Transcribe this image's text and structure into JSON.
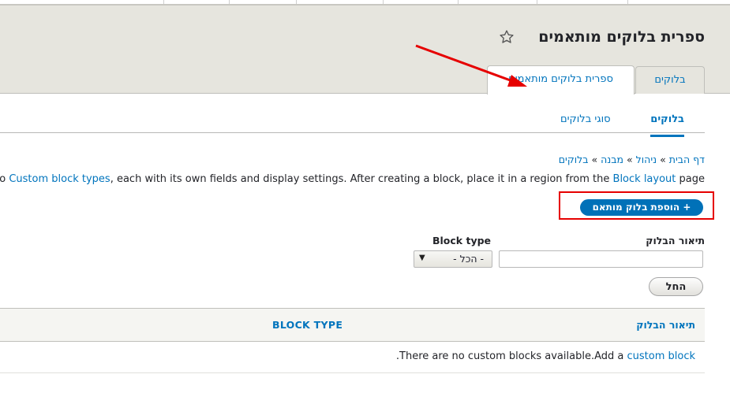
{
  "page": {
    "title": "ספרית בלוקים מותאמים"
  },
  "primary_tabs": {
    "blocks": "בלוקים",
    "library": "ספרית בלוקים מותאמים"
  },
  "secondary_tabs": {
    "blocks": "בלוקים",
    "block_types": "סוגי בלוקים"
  },
  "breadcrumb": {
    "items": [
      "דף הבית",
      "ניהול",
      "מבנה",
      "בלוקים"
    ],
    "separator": "»"
  },
  "description": {
    "prefix": "o ",
    "link1": "Custom block types",
    "middle": ", each with its own fields and display settings. After creating a block, place it in a region from the ",
    "link2": "Block layout",
    "suffix": " page"
  },
  "add_button": {
    "icon": "+",
    "label": "הוספת בלוק מותאם"
  },
  "filters": {
    "description_label": "תיאור הבלוק",
    "description_value": "",
    "type_label": "Block type",
    "type_selected": "- הכל -",
    "apply_label": "החל"
  },
  "table": {
    "col_description": "תיאור הבלוק",
    "col_type": "BLOCK TYPE",
    "empty_text_prefix": ".There are no custom blocks available.Add a ",
    "empty_link": "custom block"
  },
  "colors": {
    "link": "#0074bd",
    "button": "#0071b8",
    "highlight": "#e60000",
    "header_bg": "#e6e5de"
  },
  "icons": {
    "favorite": "star-icon",
    "select": "chevron-down-icon",
    "annotation": "red-arrow"
  }
}
